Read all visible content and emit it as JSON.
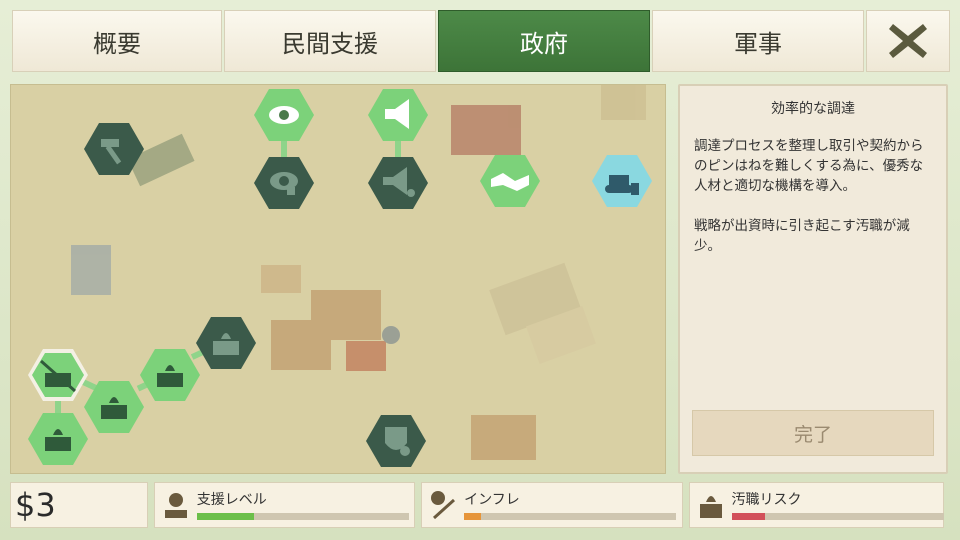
{
  "tabs": [
    {
      "label": "概要",
      "active": false
    },
    {
      "label": "民間支援",
      "active": false
    },
    {
      "label": "政府",
      "active": true
    },
    {
      "label": "軍事",
      "active": false
    }
  ],
  "close_icon": "x-icon",
  "panel": {
    "title": "効率的な調達",
    "description": "調達プロセスを整理し取引や契約からのピンはねを難しくする為に、優秀な人材と適切な機構を導入。\n\n戦略が出資時に引き起こす汚職が減少。",
    "done_label": "完了"
  },
  "money": "$3",
  "meters": [
    {
      "label": "支援レベル",
      "icon": "support-icon",
      "level": 0.27,
      "color": "#6cbf4a"
    },
    {
      "label": "インフレ",
      "icon": "inflation-icon",
      "level": 0.08,
      "color": "#e6953a"
    },
    {
      "label": "汚職リスク",
      "icon": "corruption-icon",
      "level": 0.16,
      "color": "#d2505a"
    }
  ],
  "colors": {
    "accent": "#3d7438",
    "node_bright": "#7cd27a",
    "node_dark": "#3b5a4a",
    "node_highlight": "#8ad8e0"
  },
  "nodes": [
    {
      "icon": "hammer-icon",
      "state": "dark"
    },
    {
      "icon": "eye-icon",
      "state": "bright"
    },
    {
      "icon": "eye-lock-icon",
      "state": "dark"
    },
    {
      "icon": "megaphone-icon",
      "state": "bright"
    },
    {
      "icon": "megaphone-star-icon",
      "state": "dark"
    },
    {
      "icon": "handshake-icon",
      "state": "bright"
    },
    {
      "icon": "bulldozer-icon",
      "state": "highlight"
    },
    {
      "icon": "burning-money-4-icon",
      "state": "dark"
    },
    {
      "icon": "burning-money-crossed-icon",
      "state": "selected"
    },
    {
      "icon": "burning-money-3-icon",
      "state": "bright"
    },
    {
      "icon": "burning-money-2-icon",
      "state": "bright"
    },
    {
      "icon": "burning-money-1-icon",
      "state": "bright"
    },
    {
      "icon": "shield-money-icon",
      "state": "dark"
    }
  ]
}
